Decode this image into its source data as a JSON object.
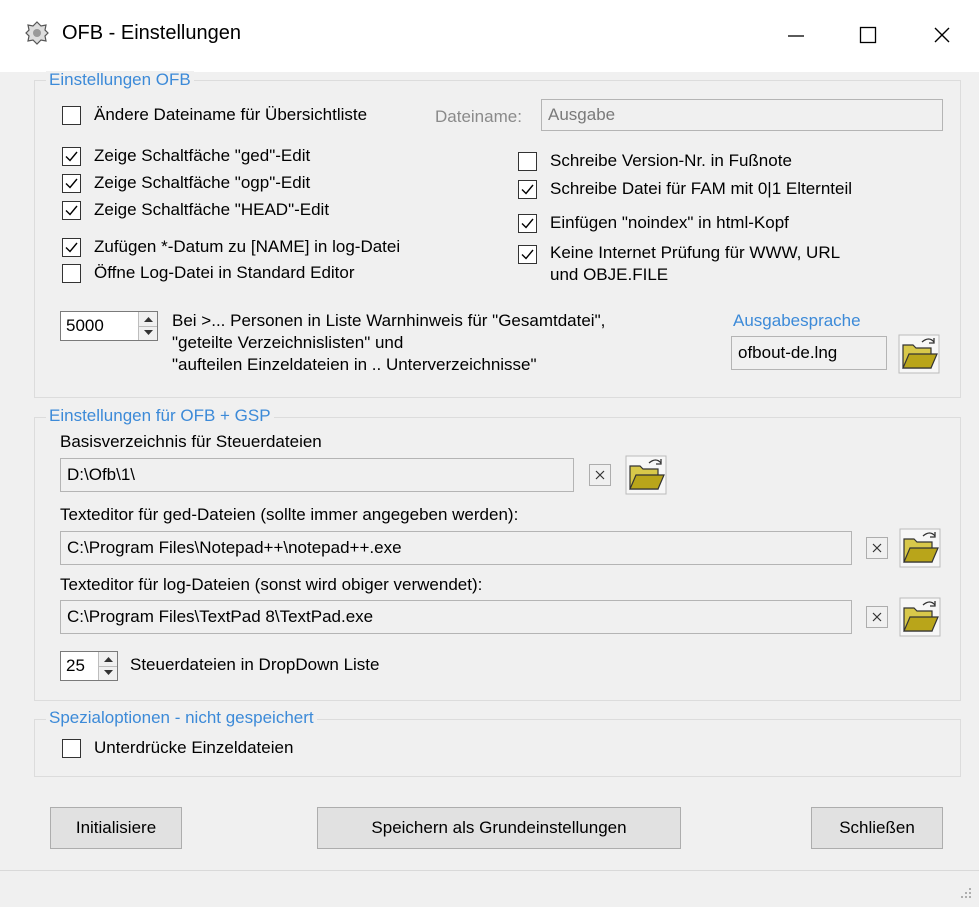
{
  "window": {
    "title": "OFB - Einstellungen",
    "minimize_glyph": "—",
    "maximize_glyph": "☐",
    "close_glyph": "✕"
  },
  "group_ofb": {
    "title": "Einstellungen OFB",
    "filename_checkbox": {
      "label": "Ändere Dateiname für Übersichtliste",
      "checked": false
    },
    "filename_label": "Dateiname:",
    "filename_value": "Ausgabe",
    "left_checks": [
      {
        "label": "Zeige Schaltfäche \"ged\"-Edit",
        "checked": true
      },
      {
        "label": "Zeige Schaltfäche \"ogp\"-Edit",
        "checked": true
      },
      {
        "label": "Zeige Schaltfäche \"HEAD\"-Edit",
        "checked": true
      },
      {
        "label": "Zufügen *-Datum zu [NAME] in log-Datei",
        "checked": true
      },
      {
        "label": "Öffne Log-Datei in Standard Editor",
        "checked": false
      }
    ],
    "right_checks": [
      {
        "label": "Schreibe Version-Nr. in Fußnote",
        "checked": false
      },
      {
        "label": "Schreibe Datei für FAM mit 0|1 Elternteil",
        "checked": true
      },
      {
        "label": "Einfügen \"noindex\" in html-Kopf",
        "checked": true
      },
      {
        "label": "Keine Internet Prüfung für WWW, URL",
        "label_line2": "und OBJE.FILE",
        "checked": true
      }
    ],
    "warn_count": "5000",
    "warn_text": [
      "Bei >... Personen in Liste Warnhinweis für \"Gesamtdatei\",",
      "\"geteilte Verzeichnislisten\" und",
      "\"aufteilen Einzeldateien in .. Unterverzeichnisse\""
    ],
    "language_label": "Ausgabesprache",
    "language_value": "ofbout-de.lng"
  },
  "group_gsp": {
    "title": "Einstellungen für OFB + GSP",
    "basedir_label": "Basisverzeichnis für Steuerdateien",
    "basedir_value": "D:\\Ofb\\1\\",
    "ged_editor_label": "Texteditor für ged-Dateien (sollte immer angegeben werden):",
    "ged_editor_value": "C:\\Program Files\\Notepad++\\notepad++.exe",
    "log_editor_label": "Texteditor für log-Dateien (sonst wird obiger verwendet):",
    "log_editor_value": "C:\\Program Files\\TextPad 8\\TextPad.exe",
    "dropdown_count": "25",
    "dropdown_label": "Steuerdateien in DropDown Liste"
  },
  "group_special": {
    "title": "Spezialoptionen - nicht gespeichert",
    "suppress_checkbox": {
      "label": "Unterdrücke Einzeldateien",
      "checked": false
    }
  },
  "buttons": {
    "initialize": "Initialisiere",
    "save_default": "Speichern als Grundeinstellungen",
    "close": "Schließen"
  },
  "icons": {
    "app": "shield-crest-icon",
    "folder": "open-folder-icon",
    "clear": "clear-x-icon",
    "check": "checkmark-icon"
  },
  "colors": {
    "group_title": "#3c8ad8",
    "folder_fill": "#b9a51a",
    "window_bg": "#f0f0f0"
  }
}
